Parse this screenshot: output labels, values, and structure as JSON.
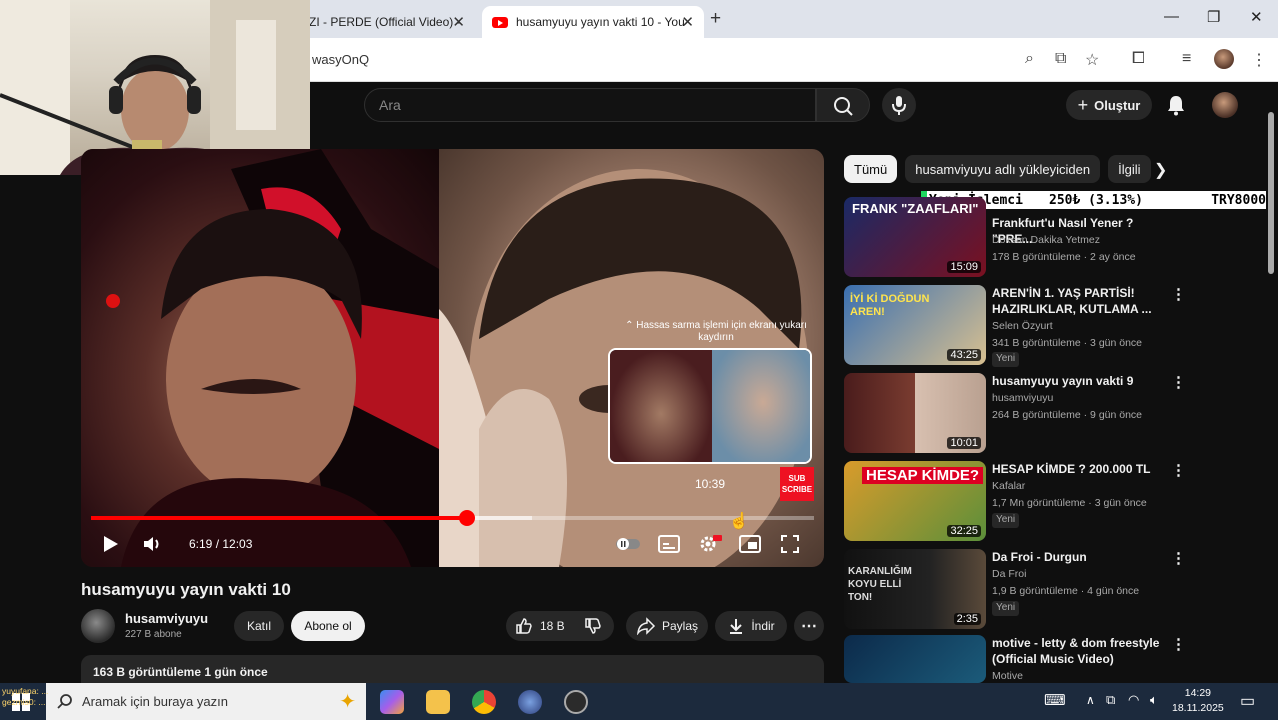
{
  "browser": {
    "tabs": [
      {
        "title": "ZI - PERDE (Official Video) - ",
        "active": false
      },
      {
        "title": "husamyuyu yayın vakti 10 - You",
        "active": true
      }
    ],
    "url": "wasyOnQ"
  },
  "youtube": {
    "search_placeholder": "Ara",
    "create_label": "Oluştur"
  },
  "player": {
    "hint": "⌃ Hassas sarma işlemi için ekranı yukarı kaydırın",
    "preview_time": "10:39",
    "sub_badge": "SUB SCRIBE",
    "current_time": "6:19",
    "duration": "12:03",
    "time_separator": " / ",
    "progress_fraction": 0.52,
    "buffer_fraction": 0.61
  },
  "video": {
    "title": "husamyuyu yayın vakti 10",
    "channel": "husamviyuyu",
    "subscribers": "227 B abone",
    "join_label": "Katıl",
    "subscribe_label": "Abone ol",
    "likes": "18 B",
    "share_label": "Paylaş",
    "download_label": "İndir",
    "description": "163 B görüntüleme  1 gün önce"
  },
  "chips": [
    "Tümü",
    "husamviyuyu adlı yükleyiciden",
    "İlgili"
  ],
  "ticker": {
    "label": "Yeni İşlemci",
    "amount": "250₺ (3.13%)",
    "goal": "TRY8000"
  },
  "recommendations": [
    {
      "title": "Frankfurt'u Nasıl Yener ? \"PRE...",
      "channel": "Doksan Dakika Yetmez",
      "meta": "178 B görüntüleme · 2 ay önce",
      "duration": "15:09",
      "new": false,
      "thumb_text": "FRANK \"ZAAFLARI\""
    },
    {
      "title": "AREN'İN 1. YAŞ PARTİSİ! HAZIRLIKLAR, KUTLAMA ...",
      "channel": "Selen Özyurt",
      "meta": "341 B görüntüleme · 3 gün önce",
      "duration": "43:25",
      "new": true,
      "thumb_text": "İYİ Kİ DOĞDUN AREN!"
    },
    {
      "title": "husamyuyu yayın vakti 9",
      "channel": "husamviyuyu",
      "meta": "264 B görüntüleme · 9 gün önce",
      "duration": "10:01",
      "new": false,
      "thumb_text": ""
    },
    {
      "title": "HESAP KİMDE ? 200.000 TL",
      "channel": "Kafalar",
      "meta": "1,7 Mn görüntüleme · 3 gün önce",
      "duration": "32:25",
      "new": true,
      "thumb_text": "HESAP KİMDE?"
    },
    {
      "title": "Da Froi - Durgun",
      "channel": "Da Froi",
      "meta": "1,9 B görüntüleme · 4 gün önce",
      "duration": "2:35",
      "new": true,
      "thumb_text": "KARANLIĞIM KOYU ELLİ TON!"
    },
    {
      "title": "motive - letty & dom freestyle (Official Music Video)",
      "channel": "Motive",
      "meta": "",
      "duration": "",
      "new": false,
      "thumb_text": ""
    }
  ],
  "new_label": "Yeni",
  "taskbar": {
    "search_placeholder": "Aramak için buraya yazın",
    "time": "14:29",
    "date": "18.11.2025"
  },
  "chat_overlay": {
    "line1": "yuyufana: ...",
    "line2": "gezmis0: ..."
  },
  "colors": {
    "accent": "#ff0000",
    "background": "#0f0f0f",
    "ticker_green": "#1ed760"
  }
}
